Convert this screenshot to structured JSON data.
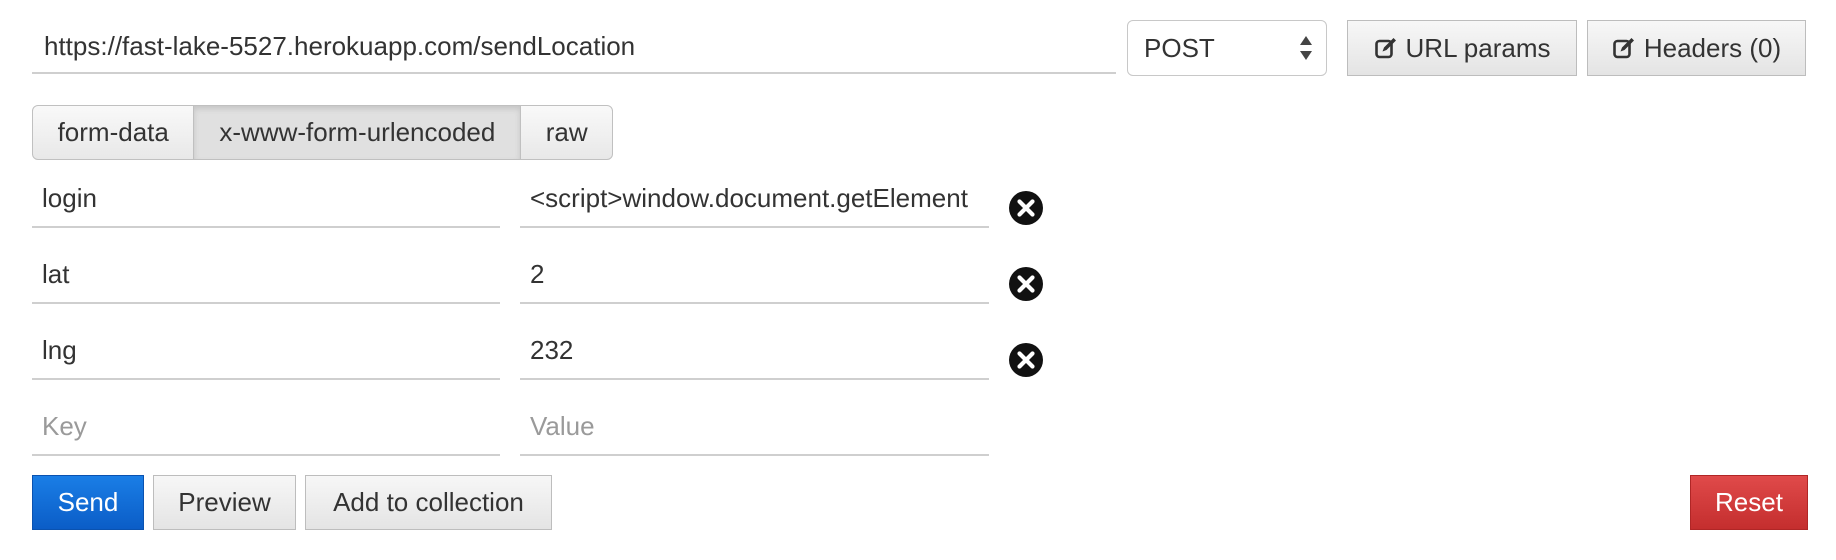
{
  "request": {
    "url": "https://fast-lake-5527.herokuapp.com/sendLocation",
    "method": "POST",
    "url_params_label": "URL params",
    "headers_label": "Headers (0)"
  },
  "body_tabs": [
    {
      "label": "form-data",
      "active": false
    },
    {
      "label": "x-www-form-urlencoded",
      "active": true
    },
    {
      "label": "raw",
      "active": false
    }
  ],
  "params": [
    {
      "key": "login",
      "value": "<script>window.document.getElement"
    },
    {
      "key": "lat",
      "value": "2"
    },
    {
      "key": "lng",
      "value": "232"
    }
  ],
  "new_param": {
    "key_placeholder": "Key",
    "value_placeholder": "Value"
  },
  "actions": {
    "send_label": "Send",
    "preview_label": "Preview",
    "add_to_collection_label": "Add to collection",
    "reset_label": "Reset"
  },
  "colors": {
    "send": "#0b5dc7",
    "reset": "#c42e2e"
  },
  "icons": {
    "edit": "edit-icon",
    "remove": "remove-circle-icon",
    "select": "select-arrows-icon"
  }
}
